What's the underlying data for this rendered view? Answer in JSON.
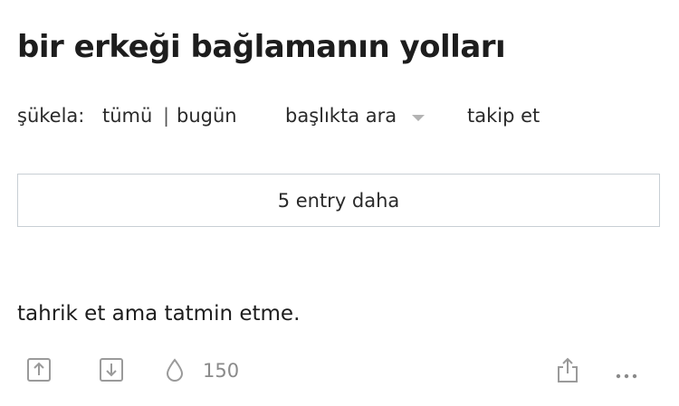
{
  "topic": {
    "title": "bir erkeği bağlamanın yolları"
  },
  "subnav": {
    "sukela_label": "şükela:",
    "all_label": "tümü",
    "separator": "|",
    "today_label": "bugün",
    "search_label": "başlıkta ara",
    "follow_label": "takip et"
  },
  "more_entries": {
    "label": "5 entry daha"
  },
  "entry": {
    "text": "tahrik et ama tatmin etme.",
    "favorite_count": "150"
  },
  "icons": {
    "upvote": "arrow-up-box-icon",
    "downvote": "arrow-down-box-icon",
    "favorite": "droplet-icon",
    "share": "share-icon",
    "more": "ellipsis-icon"
  },
  "colors": {
    "text": "#1d1d1d",
    "icon": "#9a9a9a",
    "border": "#c8cfd4",
    "caret": "#b3b3b3"
  }
}
